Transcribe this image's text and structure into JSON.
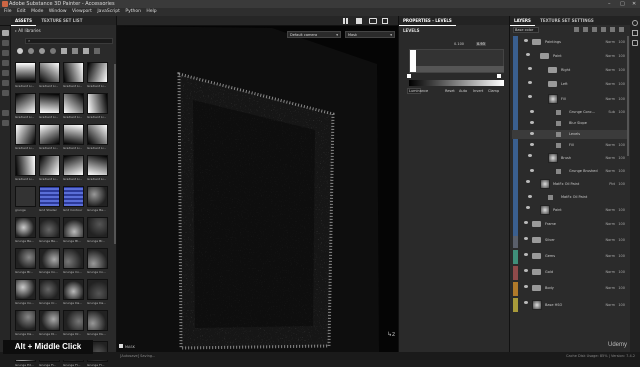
{
  "window": {
    "title": "Adobe Substance 3D Painter - Accessories"
  },
  "menu": [
    "File",
    "Edit",
    "Mode",
    "Window",
    "Viewport",
    "JavaScript",
    "Python",
    "Help"
  ],
  "assets": {
    "tabs": [
      "ASSETS",
      "TEXTURE SET LIST"
    ],
    "library": "All libraries",
    "items": [
      "Gradient Li...",
      "Gradient Li...",
      "Gradient Li...",
      "Gradient Li...",
      "Gradient Li...",
      "Gradient Li...",
      "Gradient Li...",
      "Gradient Li...",
      "Gradient Li...",
      "Gradient Li...",
      "Gradient Li...",
      "Gradient Li...",
      "Gradient Li...",
      "Gradient Li...",
      "Gradient Li...",
      "Gradient Li...",
      "grunge",
      "Grid Shader",
      "Grid Contour",
      "Grunge Ba...",
      "Grunge Be...",
      "Grunge Be...",
      "Grunge Bl...",
      "Grunge Br...",
      "Grunge Br...",
      "Grunge Co...",
      "Grunge Co...",
      "Grunge Co...",
      "Grunge Co...",
      "Grunge Cr...",
      "Grunge Da...",
      "Grunge Da...",
      "Grunge Da...",
      "Grunge Di...",
      "Grunge Dr...",
      "Grunge Du...",
      "Grunge Ed...",
      "Grunge Fi...",
      "Grunge Fl...",
      "Grunge Fl..."
    ]
  },
  "viewport": {
    "camera": "Default camera",
    "mode": "Mask",
    "mask_label": "MASK"
  },
  "properties": {
    "title": "PROPERTIES - LEVELS",
    "section": "LEVELS",
    "values": [
      "0.100",
      "0.93"
    ],
    "channel": "Luminance",
    "buttons": [
      "Reset",
      "Auto",
      "Invert",
      "Clamp"
    ]
  },
  "layers": {
    "tabs": [
      "LAYERS",
      "TEXTURE SET SETTINGS"
    ],
    "channel": "Base color",
    "items": [
      {
        "name": "Paintings",
        "kind": "folder",
        "indent": 0,
        "blend": "Norm",
        "op": "100"
      },
      {
        "name": "Paint",
        "kind": "folder",
        "indent": 1,
        "blend": "Norm",
        "op": "100"
      },
      {
        "name": "Right",
        "kind": "folder",
        "indent": 2,
        "blend": "Norm",
        "op": "100"
      },
      {
        "name": "Left",
        "kind": "folder",
        "indent": 2,
        "blend": "Norm",
        "op": "100"
      },
      {
        "name": "Fill",
        "kind": "layer",
        "indent": 2,
        "blend": "Norm",
        "op": "100"
      },
      {
        "name": "Grunge Conc...",
        "kind": "effect",
        "indent": 3,
        "blend": "Sub",
        "op": "100"
      },
      {
        "name": "Blur Slope",
        "kind": "effect",
        "indent": 3,
        "blend": "",
        "op": ""
      },
      {
        "name": "Levels",
        "kind": "effect",
        "indent": 3,
        "blend": "",
        "op": ""
      },
      {
        "name": "Fill",
        "kind": "effect",
        "indent": 3,
        "blend": "Norm",
        "op": "100"
      },
      {
        "name": "Brush",
        "kind": "layer",
        "indent": 2,
        "blend": "Norm",
        "op": "100"
      },
      {
        "name": "Grunge Brushed",
        "kind": "effect",
        "indent": 3,
        "blend": "Norm",
        "op": "100"
      },
      {
        "name": "MatFx Oil Paint",
        "kind": "layer",
        "indent": 1,
        "blend": "Pbt",
        "op": "100"
      },
      {
        "name": "MatFx Oil Paint",
        "kind": "effect",
        "indent": 2,
        "blend": "",
        "op": ""
      },
      {
        "name": "Paint",
        "kind": "layer",
        "indent": 1,
        "blend": "Norm",
        "op": "100"
      },
      {
        "name": "Frame",
        "kind": "folder",
        "indent": 0,
        "blend": "Norm",
        "op": "100"
      },
      {
        "name": "Silver",
        "kind": "folder",
        "indent": 0,
        "blend": "Norm",
        "op": "100"
      },
      {
        "name": "Gems",
        "kind": "folder",
        "indent": 0,
        "blend": "Norm",
        "op": "100"
      },
      {
        "name": "Gold",
        "kind": "folder",
        "indent": 0,
        "blend": "Norm",
        "op": "100"
      },
      {
        "name": "Body",
        "kind": "folder",
        "indent": 0,
        "blend": "Norm",
        "op": "100"
      },
      {
        "name": "Base HSO",
        "kind": "layer",
        "indent": 0,
        "blend": "Norm",
        "op": "100"
      }
    ]
  },
  "status": {
    "left": "[Autosave] Saving...",
    "right": "Cache Disk Usage: 85% | Version: 7.4.2"
  },
  "overlay": "Alt + Middle Click",
  "watermark": "Udemy"
}
